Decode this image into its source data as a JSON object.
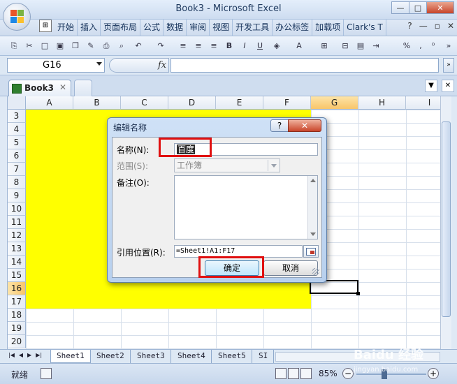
{
  "window": {
    "title": "Book3 - Microsoft Excel"
  },
  "ribbon": {
    "tabs": [
      "开始",
      "插入",
      "页面布局",
      "公式",
      "数据",
      "审阅",
      "视图",
      "开发工具",
      "办公标签",
      "加载项",
      "Clark's T"
    ]
  },
  "formula_bar": {
    "name_box": "G16",
    "fx_label": "fx",
    "value": ""
  },
  "workbook": {
    "tab_label": "Book3"
  },
  "grid": {
    "columns": [
      "A",
      "B",
      "C",
      "D",
      "E",
      "F",
      "G",
      "H",
      "I"
    ],
    "rows": [
      "3",
      "4",
      "5",
      "6",
      "7",
      "8",
      "9",
      "10",
      "11",
      "12",
      "13",
      "14",
      "15",
      "16",
      "17",
      "18",
      "19",
      "20"
    ],
    "selected_column": "G",
    "selected_row": "16",
    "fill_color": "#ffff00"
  },
  "sheets": {
    "tabs": [
      "Sheet1",
      "Sheet2",
      "Sheet3",
      "Sheet4",
      "Sheet5",
      "SI"
    ],
    "active": "Sheet1"
  },
  "status_bar": {
    "status": "就绪",
    "zoom": "85%"
  },
  "watermark": {
    "text": "Baidu 经验",
    "sub": "jingyan.baidu.com"
  },
  "dialog": {
    "title": "编辑名称",
    "help_label": "?",
    "close_label": "✕",
    "name_label": "名称(N):",
    "name_value": "百度",
    "scope_label": "范围(S):",
    "scope_value": "工作簿",
    "comment_label": "备注(O):",
    "comment_value": "",
    "refers_to_label": "引用位置(R):",
    "refers_to_value": "=Sheet1!A1:F17",
    "ok_label": "确定",
    "cancel_label": "取消",
    "highlight_color": "#e01010"
  }
}
